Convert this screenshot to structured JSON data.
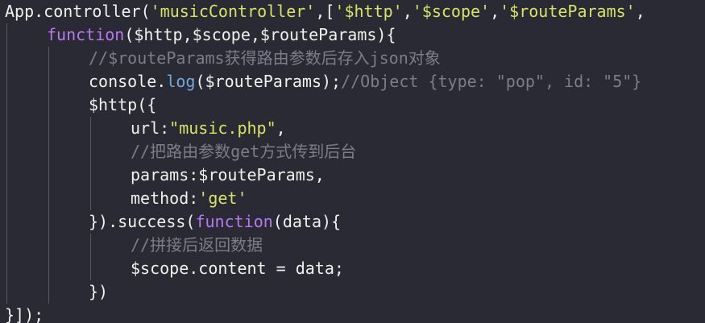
{
  "editor": {
    "colors": {
      "background": "#2a2a35",
      "plain": "#f1f1ec",
      "string": "#d9e264",
      "keyword": "#b778f0",
      "comment": "#7d7d8a",
      "method": "#6fa8dc",
      "indent_guide": "#565665"
    },
    "lines": [
      {
        "indent": 0,
        "tokens": [
          {
            "text": "App.controller(",
            "type": "plain"
          },
          {
            "text": "'musicController'",
            "type": "string"
          },
          {
            "text": ",[",
            "type": "plain"
          },
          {
            "text": "'$http'",
            "type": "string"
          },
          {
            "text": ",",
            "type": "plain"
          },
          {
            "text": "'$scope'",
            "type": "string"
          },
          {
            "text": ",",
            "type": "plain"
          },
          {
            "text": "'$routeParams'",
            "type": "string"
          },
          {
            "text": ",",
            "type": "plain"
          }
        ]
      },
      {
        "indent": 1,
        "tokens": [
          {
            "text": "function",
            "type": "keyword"
          },
          {
            "text": "($http,$scope,$routeParams){",
            "type": "plain"
          }
        ]
      },
      {
        "indent": 2,
        "tokens": [
          {
            "text": "//$routeParams获得路由参数后存入json对象",
            "type": "comment"
          }
        ]
      },
      {
        "indent": 2,
        "tokens": [
          {
            "text": "console.",
            "type": "plain"
          },
          {
            "text": "log",
            "type": "method"
          },
          {
            "text": "($routeParams);",
            "type": "plain"
          },
          {
            "text": "//Object {type: \"pop\", id: \"5\"}",
            "type": "comment"
          }
        ]
      },
      {
        "indent": 2,
        "tokens": [
          {
            "text": "$http({",
            "type": "plain"
          }
        ]
      },
      {
        "indent": 3,
        "tokens": [
          {
            "text": "url:",
            "type": "plain"
          },
          {
            "text": "\"music.php\"",
            "type": "string"
          },
          {
            "text": ",",
            "type": "plain"
          }
        ]
      },
      {
        "indent": 3,
        "tokens": [
          {
            "text": "//把路由参数get方式传到后台",
            "type": "comment"
          }
        ]
      },
      {
        "indent": 3,
        "tokens": [
          {
            "text": "params:$routeParams,",
            "type": "plain"
          }
        ]
      },
      {
        "indent": 3,
        "tokens": [
          {
            "text": "method:",
            "type": "plain"
          },
          {
            "text": "'get'",
            "type": "string"
          }
        ]
      },
      {
        "indent": 2,
        "tokens": [
          {
            "text": "}).success(",
            "type": "plain"
          },
          {
            "text": "function",
            "type": "keyword"
          },
          {
            "text": "(data){",
            "type": "plain"
          }
        ]
      },
      {
        "indent": 3,
        "tokens": [
          {
            "text": "//拼接后返回数据",
            "type": "comment"
          }
        ]
      },
      {
        "indent": 3,
        "tokens": [
          {
            "text": "$scope.content = data;",
            "type": "plain"
          }
        ]
      },
      {
        "indent": 2,
        "tokens": [
          {
            "text": "})",
            "type": "plain"
          }
        ]
      },
      {
        "indent": 0,
        "tokens": [
          {
            "text": "}]);",
            "type": "plain"
          }
        ]
      }
    ]
  }
}
